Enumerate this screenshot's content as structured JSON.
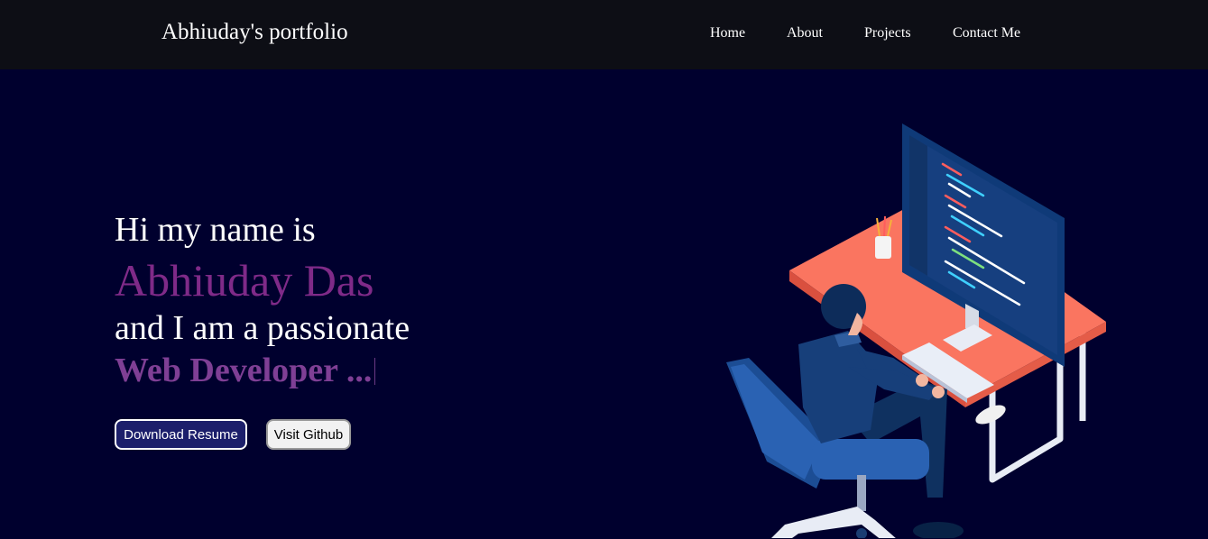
{
  "navbar": {
    "brand": "Abhiuday's portfolio",
    "links": [
      {
        "label": "Home"
      },
      {
        "label": "About"
      },
      {
        "label": "Projects"
      },
      {
        "label": "Contact Me"
      }
    ]
  },
  "hero": {
    "greeting": "Hi my name is",
    "name": "Abhiuday Das",
    "tagline": "and I am a passionate",
    "role": "Web Developer ...",
    "buttons": {
      "resume_label": "Download Resume",
      "github_label": "Visit Github"
    }
  },
  "colors": {
    "navbar_bg": "#0d0e15",
    "page_bg": "#00002e",
    "name_accent": "#7f2a88",
    "role_accent": "#7f3f95",
    "resume_button_bg": "#1c1f6b"
  },
  "icons": {
    "illustration": "developer-at-desk-illustration"
  }
}
